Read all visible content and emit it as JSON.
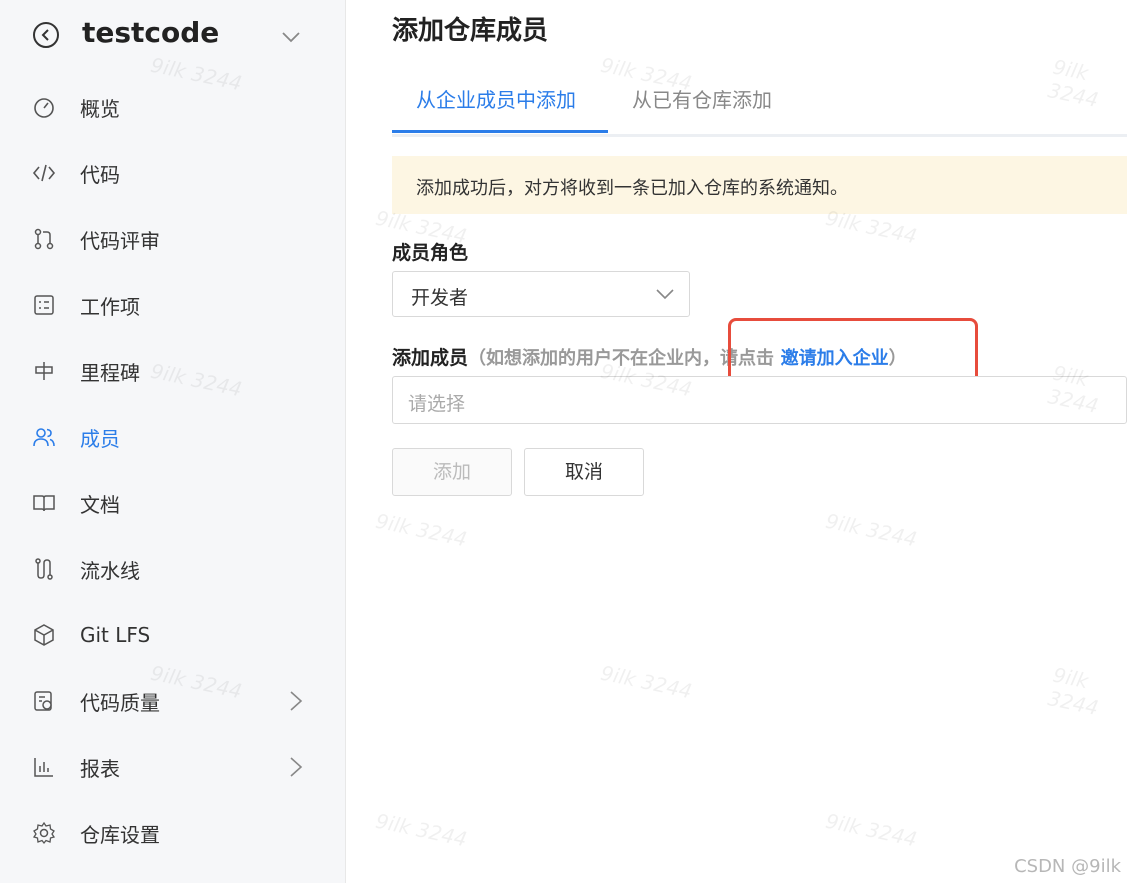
{
  "sidebar": {
    "repo_name": "testcode",
    "items": [
      {
        "label": "概览",
        "icon": "dashboard-icon"
      },
      {
        "label": "代码",
        "icon": "code-icon"
      },
      {
        "label": "代码评审",
        "icon": "merge-request-icon"
      },
      {
        "label": "工作项",
        "icon": "checklist-icon"
      },
      {
        "label": "里程碑",
        "icon": "signpost-icon"
      },
      {
        "label": "成员",
        "icon": "users-icon",
        "active": true
      },
      {
        "label": "文档",
        "icon": "book-icon"
      },
      {
        "label": "流水线",
        "icon": "pipeline-icon"
      },
      {
        "label": "Git LFS",
        "icon": "cube-icon"
      },
      {
        "label": "代码质量",
        "icon": "quality-icon",
        "has_arrow": true
      },
      {
        "label": "报表",
        "icon": "bar-chart-icon",
        "has_arrow": true
      },
      {
        "label": "仓库设置",
        "icon": "gear-icon"
      }
    ]
  },
  "main": {
    "title": "添加仓库成员",
    "tabs": [
      {
        "label": "从企业成员中添加",
        "active": true
      },
      {
        "label": "从已有仓库添加",
        "active": false
      }
    ],
    "notice": "添加成功后，对方将收到一条已加入仓库的系统通知。",
    "role_label": "成员角色",
    "role_value": "开发者",
    "member_label": "添加成员",
    "member_hint_prefix": "（如想添加的用户不在企业内，请点击",
    "member_hint_link": "邀请加入企业",
    "member_hint_suffix": "）",
    "member_placeholder": "请选择",
    "add_button": "添加",
    "cancel_button": "取消"
  },
  "watermarks": {
    "text": "9ilk 3244",
    "csdn": "CSDN @9ilk"
  },
  "colors": {
    "accent": "#2b7de9",
    "notice_bg": "#fdf6e3",
    "highlight": "#e74c3c"
  }
}
